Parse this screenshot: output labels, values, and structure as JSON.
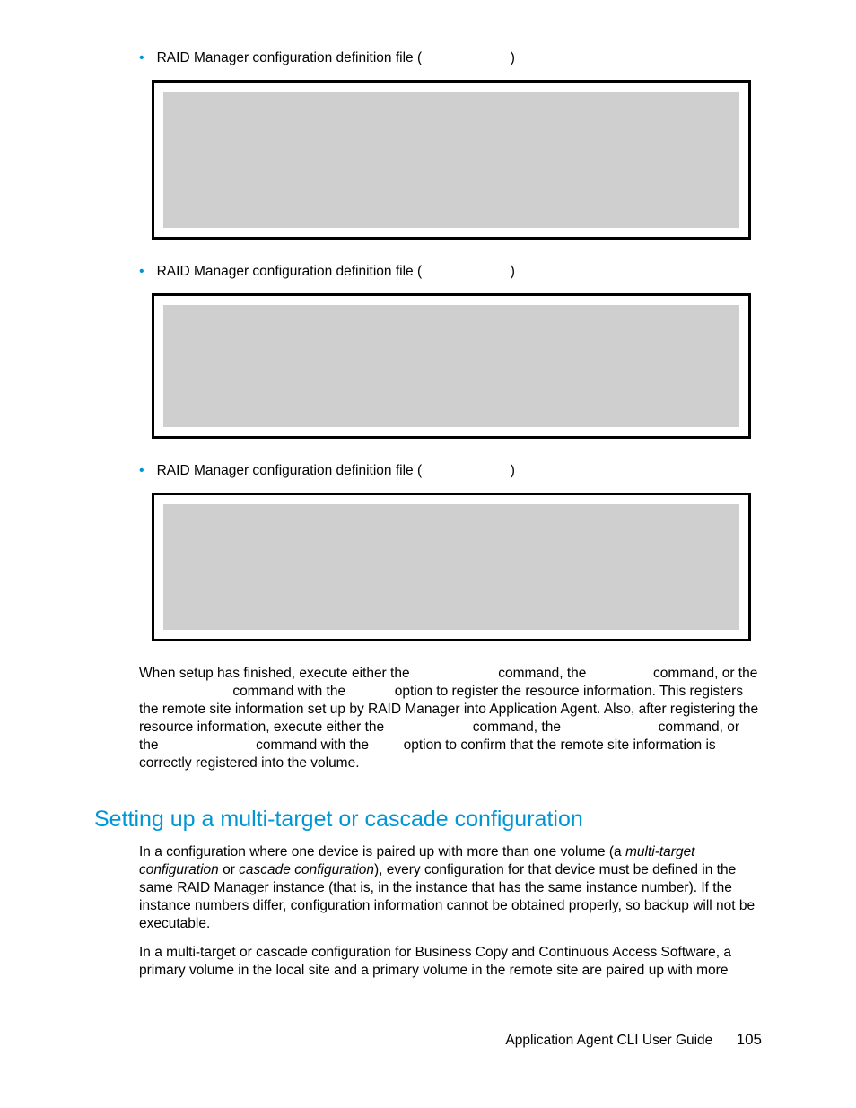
{
  "bullets": [
    {
      "pre": "RAID Manager configuration definition file (",
      "post": ")"
    },
    {
      "pre": "RAID Manager configuration definition file (",
      "post": ")"
    },
    {
      "pre": "RAID Manager configuration definition file (",
      "post": ")"
    }
  ],
  "para1": {
    "t1": "When setup has finished, execute either the ",
    "t2": " command, the ",
    "t3": " command, or the ",
    "t4": " command with the ",
    "t5": " option to register the resource information. This registers the remote site information set up by RAID Manager into Application Agent. Also, after registering the resource information, execute either the ",
    "t6": " command, the ",
    "t7": " command, or the ",
    "t8": " command with the ",
    "t9": " option to confirm that the remote site information is correctly registered into the volume."
  },
  "heading": "Setting up a multi-target or cascade configuration",
  "para2": {
    "t1": "In a configuration where one device is paired up with more than one volume (a ",
    "i1": "multi-target configuration",
    "t2": " or ",
    "i2": "cascade configuration",
    "t3": "), every configuration for that device must be defined in the same RAID Manager instance (that is, in the instance that has the same instance number). If the instance numbers differ, configuration information cannot be obtained properly, so backup will not be executable."
  },
  "para3": "In a multi-target or cascade configuration for Business Copy and Continuous Access Software, a primary volume in the local site and a primary volume in the remote site are paired up with more",
  "footer": {
    "title": "Application Agent CLI User Guide",
    "page": "105"
  }
}
